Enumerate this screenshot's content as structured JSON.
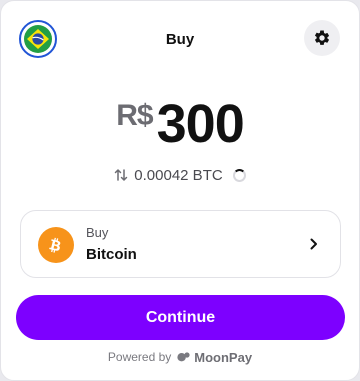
{
  "header": {
    "title": "Buy",
    "flag_icon": "brazil-flag-icon",
    "settings_icon": "gear-icon"
  },
  "amount": {
    "currency_symbol": "R$",
    "value": "300"
  },
  "conversion": {
    "text": "0.00042 BTC",
    "icon": "swap-arrows-icon",
    "loading": true
  },
  "asset": {
    "label": "Buy",
    "name": "Bitcoin",
    "icon": "bitcoin-icon",
    "icon_color": "#f7931a"
  },
  "continue_button": {
    "label": "Continue",
    "color": "#7d00ff"
  },
  "footer": {
    "powered_by": "Powered by",
    "brand": "MoonPay"
  }
}
